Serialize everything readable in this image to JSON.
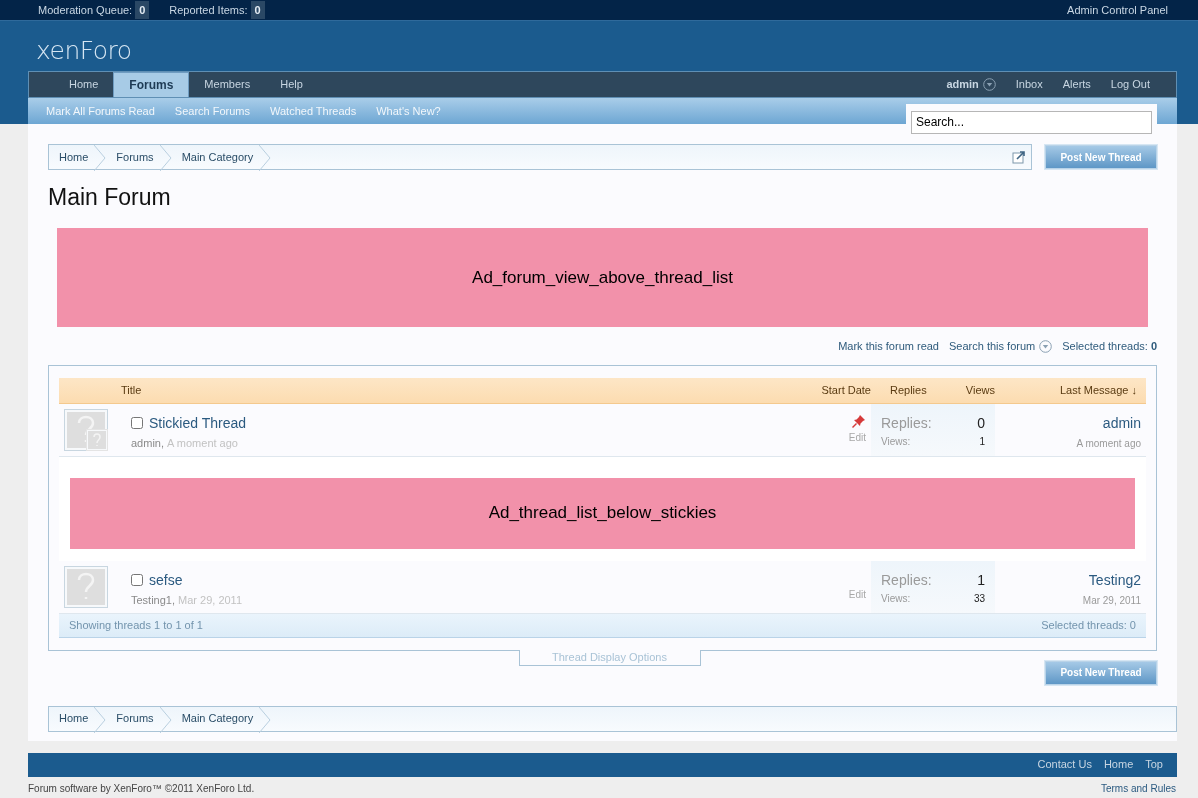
{
  "moderator_bar": {
    "items": [
      {
        "label": "Moderation Queue:",
        "count": "0"
      },
      {
        "label": "Reported Items:",
        "count": "0"
      }
    ],
    "admin_link": "Admin Control Panel"
  },
  "logo": "xenForo",
  "nav": {
    "tabs": [
      {
        "label": "Home",
        "selected": false
      },
      {
        "label": "Forums",
        "selected": true
      },
      {
        "label": "Members",
        "selected": false
      },
      {
        "label": "Help",
        "selected": false
      }
    ],
    "account": [
      {
        "label": "admin",
        "kind": "menu"
      },
      {
        "label": "Inbox",
        "kind": "link"
      },
      {
        "label": "Alerts",
        "kind": "link"
      },
      {
        "label": "Log Out",
        "kind": "link"
      }
    ],
    "subnav": [
      "Mark All Forums Read",
      "Search Forums",
      "Watched Threads",
      "What's New?"
    ]
  },
  "search": {
    "placeholder": "Search..."
  },
  "breadcrumb": [
    "Home",
    "Forums",
    "Main Category"
  ],
  "post_button": "Post New Thread",
  "title": "Main Forum",
  "ad_top": "Ad_forum_view_above_thread_list",
  "forum_tools": {
    "links": [
      {
        "label": "Mark this forum read",
        "kind": "link"
      },
      {
        "label": "Search this forum",
        "kind": "menu"
      }
    ],
    "selected_label": "Selected threads:",
    "selected_count": "0"
  },
  "table": {
    "columns": [
      "Title",
      "Start Date",
      "Replies",
      "Views",
      "Last Message ↓"
    ],
    "rows": [
      {
        "kind": "thread",
        "title": "Stickied Thread",
        "author": "admin,",
        "date": "A moment ago",
        "checked": false,
        "sticky": true,
        "poster_avatar": true,
        "edit": "Edit",
        "replies_label": "Replies:",
        "replies": "0",
        "views_label": "Views:",
        "views": "1",
        "last_user": "admin",
        "last_date": "A moment ago"
      },
      {
        "kind": "ad",
        "text": "Ad_thread_list_below_stickies"
      },
      {
        "kind": "thread",
        "title": "sefse",
        "author": "Testing1,",
        "date": "Mar 29, 2011",
        "checked": false,
        "sticky": false,
        "poster_avatar": false,
        "edit": "Edit",
        "replies_label": "Replies:",
        "replies": "1",
        "views_label": "Views:",
        "views": "33",
        "last_user": "Testing2",
        "last_date": "Mar 29, 2011"
      }
    ],
    "showing": "Showing threads 1 to 1 of 1",
    "selected": "Selected threads: 0"
  },
  "display_options": "Thread Display Options",
  "post_button_bottom": "Post New Thread",
  "breadcrumb_bottom": [
    "Home",
    "Forums",
    "Main Category"
  ],
  "footer": {
    "links": [
      "Contact Us",
      "Home",
      "Top"
    ],
    "copyright": "Forum software by XenForo™ ©2011 XenForo Ltd.",
    "terms": "Terms and Rules"
  }
}
